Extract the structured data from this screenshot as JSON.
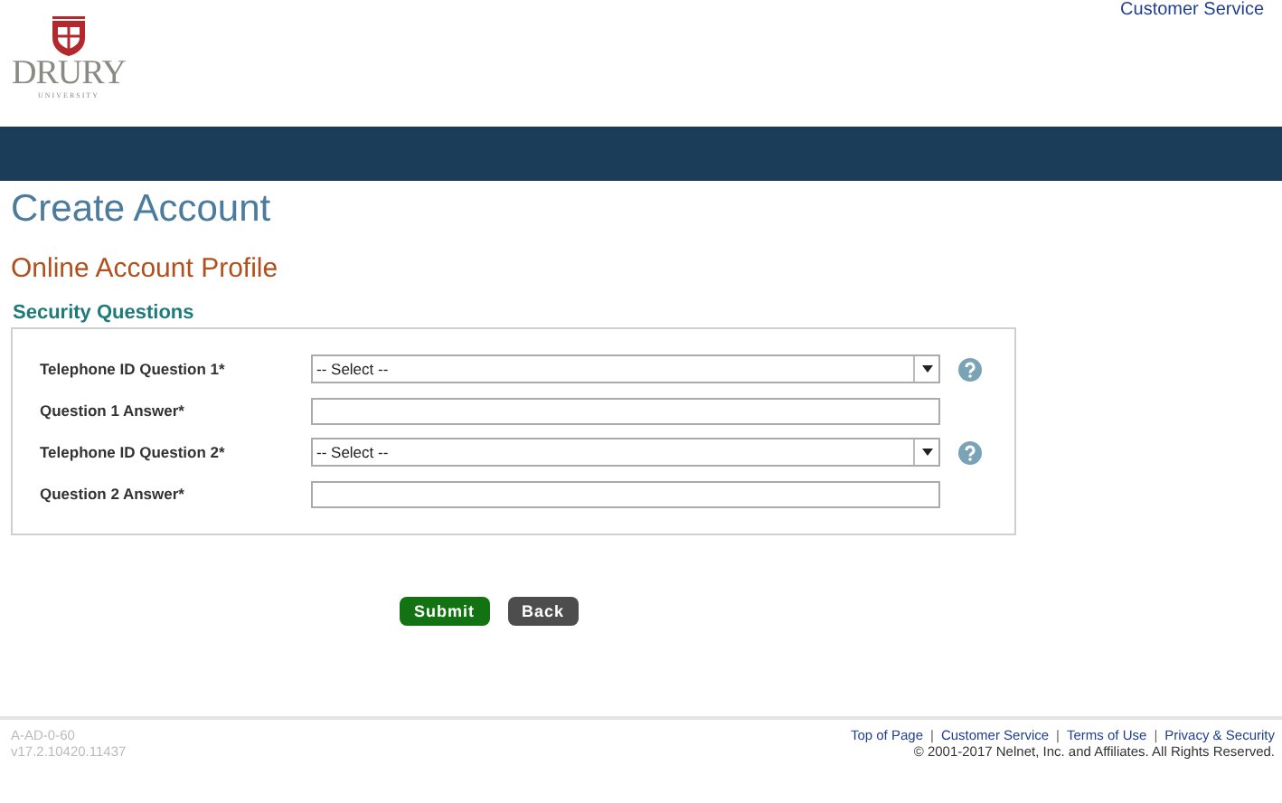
{
  "header": {
    "logo_name": "DRURY",
    "logo_subtitle": "UNIVERSITY",
    "top_link": "Customer Service"
  },
  "page_title": "Create Account",
  "section_title": "Online Account Profile",
  "form": {
    "legend": "Security Questions",
    "fields": [
      {
        "kind": "select",
        "label": "Telephone ID Question 1*",
        "value": "-- Select --"
      },
      {
        "kind": "text",
        "label": "Question 1 Answer*"
      },
      {
        "kind": "select",
        "label": "Telephone ID Question 2*",
        "value": "-- Select --"
      },
      {
        "kind": "text",
        "label": "Question 2 Answer*"
      }
    ]
  },
  "buttons": [
    {
      "kind": "primary",
      "label": "Submit"
    },
    {
      "kind": "secondary",
      "label": "Back"
    }
  ],
  "footer": {
    "codes": [
      "A-AD-0-60",
      "v17.2.10420.11437"
    ],
    "links": [
      "Top of Page",
      "Customer Service",
      "Terms of Use",
      "Privacy & Security"
    ],
    "separator": "|",
    "copyright": "© 2001-2017 Nelnet, Inc. and Affiliates. All Rights Reserved."
  }
}
